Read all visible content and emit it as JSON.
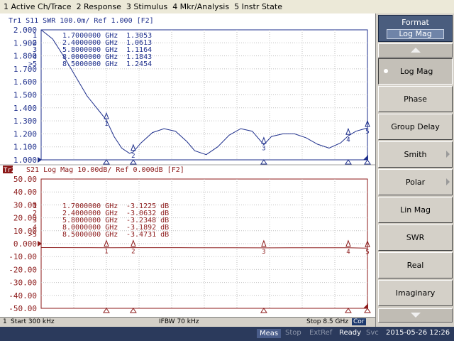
{
  "menu": [
    "1 Active Ch/Trace",
    "2 Response",
    "3 Stimulus",
    "4 Mkr/Analysis",
    "5 Instr State"
  ],
  "trace1": {
    "header": "Tr1 S11 SWR 100.0m/ Ref 1.000 [F2]",
    "color": "#1e2f8c",
    "y_ticks": [
      "2.000",
      "1.900",
      "1.800",
      "1.700",
      "1.600",
      "1.500",
      "1.400",
      "1.300",
      "1.200",
      "1.100",
      "1.000"
    ],
    "markers": [
      {
        "id": "1",
        "freq": "1.7000000 GHz",
        "value": "1.3053"
      },
      {
        "id": "2",
        "freq": "2.4000000 GHz",
        "value": "1.0613"
      },
      {
        "id": "3",
        "freq": "5.8000000 GHz",
        "value": "1.1164"
      },
      {
        "id": "4",
        "freq": "8.0000000 GHz",
        "value": "1.1843"
      },
      {
        "id": ">5",
        "freq": "8.5000000 GHz",
        "value": "1.2454"
      }
    ]
  },
  "trace2": {
    "badge": "Tr2",
    "header": "S21 Log Mag 10.00dB/ Ref 0.000dB [F2]",
    "color": "#8c1a1a",
    "y_ticks": [
      "50.00",
      "40.00",
      "30.00",
      "20.00",
      "10.00",
      "0.000",
      "-10.00",
      "-20.00",
      "-30.00",
      "-40.00",
      "-50.00"
    ],
    "markers": [
      {
        "id": "1",
        "freq": "1.7000000 GHz",
        "value": "-3.1225 dB"
      },
      {
        "id": "2",
        "freq": "2.4000000 GHz",
        "value": "-3.0632 dB"
      },
      {
        "id": "3",
        "freq": "5.8000000 GHz",
        "value": "-3.2348 dB"
      },
      {
        "id": "4",
        "freq": "8.0000000 GHz",
        "value": "-3.1892 dB"
      },
      {
        "id": ">5",
        "freq": "8.5000000 GHz",
        "value": "-3.4731 dB"
      }
    ]
  },
  "channel_status": {
    "ch": "1",
    "start": "Start 300 kHz",
    "ifbw": "IFBW 70 kHz",
    "stop": "Stop 8.5 GHz",
    "cor": "Cor"
  },
  "softkeys": {
    "title": "Format",
    "current": "Log Mag",
    "items": [
      {
        "label": "Log Mag",
        "selected": true,
        "submenu": false
      },
      {
        "label": "Phase",
        "selected": false,
        "submenu": false
      },
      {
        "label": "Group Delay",
        "selected": false,
        "submenu": false
      },
      {
        "label": "Smith",
        "selected": false,
        "submenu": true
      },
      {
        "label": "Polar",
        "selected": false,
        "submenu": true
      },
      {
        "label": "Lin Mag",
        "selected": false,
        "submenu": false
      },
      {
        "label": "SWR",
        "selected": false,
        "submenu": false
      },
      {
        "label": "Real",
        "selected": false,
        "submenu": false
      },
      {
        "label": "Imaginary",
        "selected": false,
        "submenu": false
      }
    ]
  },
  "instrument_status": {
    "meas": "Meas",
    "stop": "Stop",
    "extref": "ExtRef",
    "ready": "Ready",
    "svc": "Svc",
    "datetime": "2015-05-26 12:26"
  },
  "chart_data": [
    {
      "type": "line",
      "title": "Tr1 S11 SWR 100.0m/ Ref 1.000 [F2]",
      "xlabel": "",
      "ylabel": "",
      "x_unit": "GHz",
      "xlim": [
        0.0003,
        8.5
      ],
      "ylim": [
        1.0,
        2.0
      ],
      "grid": true,
      "series": [
        {
          "name": "S11",
          "x": [
            0.0003,
            0.3,
            0.6,
            0.9,
            1.2,
            1.5,
            1.7,
            1.9,
            2.1,
            2.3,
            2.4,
            2.6,
            2.9,
            3.2,
            3.5,
            3.8,
            4.0,
            4.3,
            4.6,
            4.9,
            5.2,
            5.5,
            5.8,
            6.0,
            6.3,
            6.6,
            6.9,
            7.2,
            7.5,
            7.8,
            8.0,
            8.2,
            8.5
          ],
          "y": [
            2.0,
            1.93,
            1.79,
            1.64,
            1.49,
            1.38,
            1.3053,
            1.18,
            1.09,
            1.05,
            1.0613,
            1.13,
            1.21,
            1.24,
            1.22,
            1.14,
            1.07,
            1.04,
            1.1,
            1.19,
            1.24,
            1.22,
            1.1164,
            1.18,
            1.2,
            1.2,
            1.17,
            1.12,
            1.09,
            1.13,
            1.1843,
            1.22,
            1.2454
          ]
        }
      ],
      "markers": [
        {
          "id": "1",
          "x": 1.7,
          "y": 1.3053
        },
        {
          "id": "2",
          "x": 2.4,
          "y": 1.0613
        },
        {
          "id": "3",
          "x": 5.8,
          "y": 1.1164
        },
        {
          "id": "4",
          "x": 8.0,
          "y": 1.1843
        },
        {
          "id": "5",
          "x": 8.5,
          "y": 1.2454
        }
      ]
    },
    {
      "type": "line",
      "title": "S21 Log Mag 10.00dB/ Ref 0.000dB [F2]",
      "xlabel": "",
      "ylabel": "",
      "x_unit": "GHz",
      "xlim": [
        0.0003,
        8.5
      ],
      "ylim": [
        -50,
        50
      ],
      "grid": true,
      "series": [
        {
          "name": "S21",
          "x": [
            0.0003,
            1.0,
            1.7,
            2.4,
            3.0,
            4.0,
            5.0,
            5.8,
            6.5,
            7.2,
            8.0,
            8.5
          ],
          "y": [
            -3.0,
            -3.05,
            -3.1225,
            -3.0632,
            -3.1,
            -3.15,
            -3.18,
            -3.2348,
            -3.2,
            -3.15,
            -3.1892,
            -3.4731
          ]
        }
      ],
      "markers": [
        {
          "id": "1",
          "x": 1.7,
          "y": -3.1225
        },
        {
          "id": "2",
          "x": 2.4,
          "y": -3.0632
        },
        {
          "id": "3",
          "x": 5.8,
          "y": -3.2348
        },
        {
          "id": "4",
          "x": 8.0,
          "y": -3.1892
        },
        {
          "id": "5",
          "x": 8.5,
          "y": -3.4731
        }
      ]
    }
  ]
}
